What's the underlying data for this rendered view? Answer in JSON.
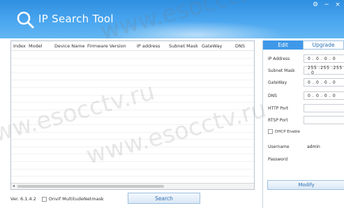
{
  "app": {
    "title": "IP Search Tool"
  },
  "window_controls": {
    "settings": "⚙",
    "minimize": "−",
    "close": "×"
  },
  "table": {
    "columns": [
      "Index",
      "Model",
      "Device Name",
      "Firmware Version",
      "IP address",
      "Subnet Mask",
      "GateWay",
      "DNS"
    ],
    "rows": []
  },
  "footer": {
    "version": "Ver. 6.1.4.2",
    "onvif_label": "Onvif MultitudeNetmask",
    "search_label": "Search"
  },
  "panel": {
    "tabs": [
      {
        "label": "Edit",
        "active": true
      },
      {
        "label": "Upgrade",
        "active": false
      }
    ],
    "fields": {
      "ip_label": "IP Address",
      "ip_value": "0 . 0 . 0 . 0",
      "subnet_label": "Subnet Mask",
      "subnet_value": "255 .255 .255 . 0",
      "gateway_label": "GateWay",
      "gateway_value": "0 . 0 . 0 . 0",
      "dns_label": "DNS",
      "dns_value": "0 . 0 . 0 . 0",
      "http_label": "HTTP Port",
      "http_value": "",
      "rtsp_label": "RTSP Port",
      "rtsp_value": "",
      "dhcp_label": "DHCP Enable",
      "username_label": "Username",
      "username_value": "admin",
      "password_label": "Password",
      "password_value": ""
    },
    "modify_label": "Modify"
  },
  "watermark_text": "www.esocctv.ru",
  "colors": {
    "titlebar": "#3f98e8",
    "accent": "#3f98e8",
    "button_text": "#2d6fb4"
  }
}
